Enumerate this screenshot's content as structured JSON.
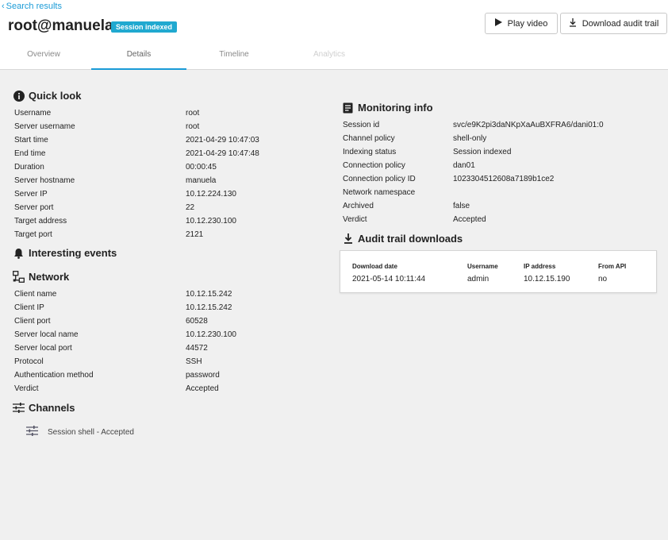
{
  "header": {
    "back_label": "Search results",
    "title": "root@manuela",
    "badge": "Session indexed",
    "play_label": "Play video",
    "download_label": "Download audit trail"
  },
  "tabs": [
    {
      "label": "Overview",
      "state": "normal"
    },
    {
      "label": "Details",
      "state": "active"
    },
    {
      "label": "Timeline",
      "state": "normal"
    },
    {
      "label": "Analytics",
      "state": "disabled"
    }
  ],
  "quick_look": {
    "heading": "Quick look",
    "rows": [
      {
        "k": "Username",
        "v": "root"
      },
      {
        "k": "Server username",
        "v": "root"
      },
      {
        "k": "Start time",
        "v": "2021-04-29 10:47:03"
      },
      {
        "k": "End time",
        "v": "2021-04-29 10:47:48"
      },
      {
        "k": "Duration",
        "v": "00:00:45"
      },
      {
        "k": "Server hostname",
        "v": "manuela"
      },
      {
        "k": "Server IP",
        "v": "10.12.224.130"
      },
      {
        "k": "Server port",
        "v": "22"
      },
      {
        "k": "Target address",
        "v": "10.12.230.100"
      },
      {
        "k": "Target port",
        "v": "2121"
      }
    ]
  },
  "interesting_events": {
    "heading": "Interesting events"
  },
  "network": {
    "heading": "Network",
    "rows": [
      {
        "k": "Client name",
        "v": "10.12.15.242"
      },
      {
        "k": "Client IP",
        "v": "10.12.15.242"
      },
      {
        "k": "Client port",
        "v": "60528"
      },
      {
        "k": "Server local name",
        "v": "10.12.230.100"
      },
      {
        "k": "Server local port",
        "v": "44572"
      },
      {
        "k": "Protocol",
        "v": "SSH"
      },
      {
        "k": "Authentication method",
        "v": "password"
      },
      {
        "k": "Verdict",
        "v": "Accepted"
      }
    ]
  },
  "channels": {
    "heading": "Channels",
    "items": [
      {
        "label": "Session shell - Accepted"
      }
    ]
  },
  "monitoring": {
    "heading": "Monitoring info",
    "rows": [
      {
        "k": "Session id",
        "v": "svc/e9K2pi3daNKpXaAuBXFRA6/dani01:0"
      },
      {
        "k": "Channel policy",
        "v": "shell-only"
      },
      {
        "k": "Indexing status",
        "v": "Session indexed"
      },
      {
        "k": "Connection policy",
        "v": "dan01"
      },
      {
        "k": "Connection policy ID",
        "v": "1023304512608a7189b1ce2"
      },
      {
        "k": "Network namespace",
        "v": ""
      },
      {
        "k": "Archived",
        "v": "false"
      },
      {
        "k": "Verdict",
        "v": "Accepted"
      }
    ]
  },
  "audit": {
    "heading": "Audit trail downloads",
    "columns": [
      "Download date",
      "Username",
      "IP address",
      "From API"
    ],
    "row": [
      "2021-05-14 10:11:44",
      "admin",
      "10.12.15.190",
      "no"
    ]
  },
  "colors": {
    "accent": "#1a9bd7",
    "badge": "#20a9d0",
    "panel_bg": "#f0f0f0"
  }
}
